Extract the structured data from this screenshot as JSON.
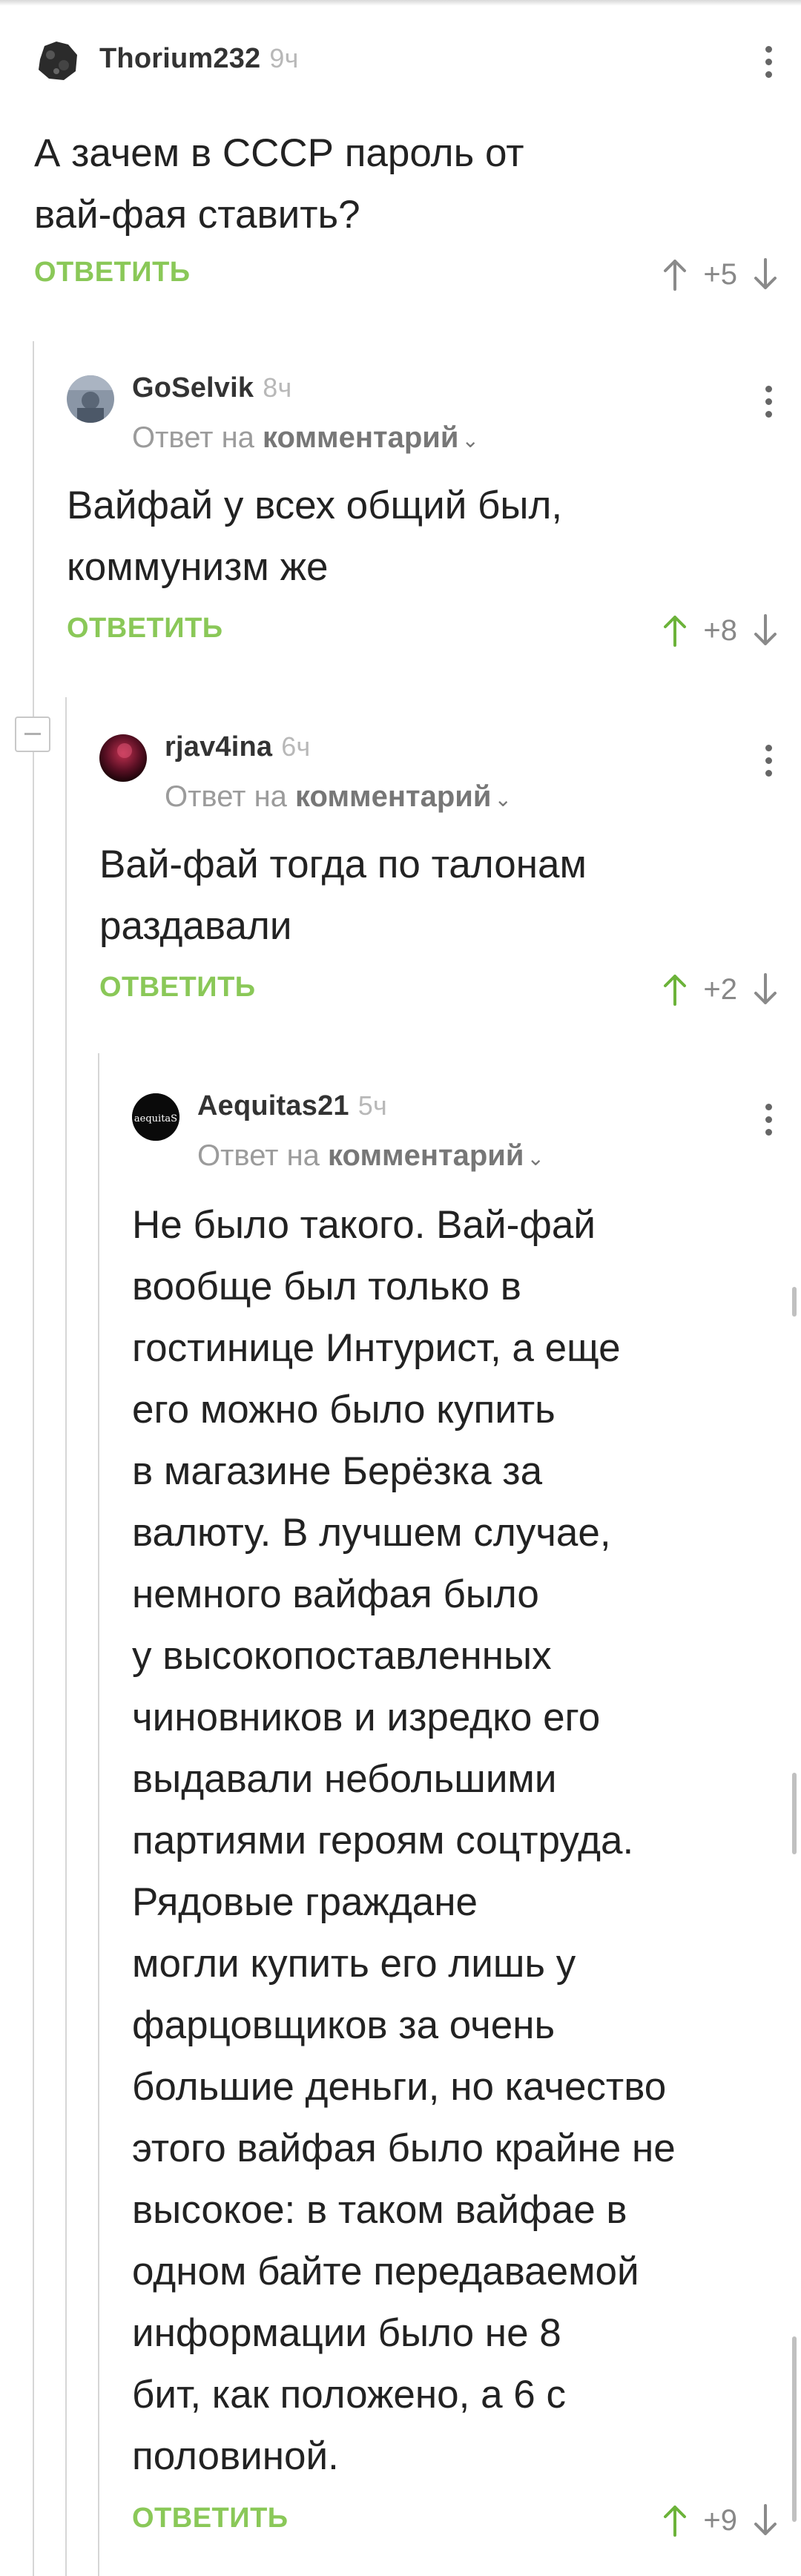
{
  "comments": [
    {
      "author": "Thorium232",
      "time": "9ч",
      "text": "А зачем в СССР пароль от\nвай-фая ставить?",
      "reply_label": "ОТВЕТИТЬ",
      "score": "+5"
    },
    {
      "author": "GoSelvik",
      "time": "8ч",
      "reply_prefix": "Ответ на",
      "reply_target": "комментарий",
      "text": "Вайфай у всех общий был,\nкоммунизм же",
      "reply_label": "ОТВЕТИТЬ",
      "score": "+8"
    },
    {
      "author": "rjav4ina",
      "time": "6ч",
      "reply_prefix": "Ответ на",
      "reply_target": "комментарий",
      "text": "Вай-фай тогда по талонам\nраздавали",
      "reply_label": "ОТВЕТИТЬ",
      "score": "+2"
    },
    {
      "author": "Aequitas21",
      "time": "5ч",
      "reply_prefix": "Ответ на",
      "reply_target": "комментарий",
      "avatar_text": "aequitaS",
      "text": "Не было такого. Вай-фай\nвообще был только в\nгостинице Интурист, а еще\nего можно было купить\nв магазине Берёзка за\nвалюту. В лучшем случае,\nнемного вайфая было\nу высокопоставленных\nчиновников и изредко его\nвыдавали небольшими\nпартиями героям соцтруда.\nРядовые граждане\nмогли купить его лишь у\nфарцовщиков за очень\nбольшие деньги, но качество\nэтого вайфая было крайне не\nвысокое: в таком вайфае в\nодном байте передаваемой\nинформации было не 8\nбит, как положено, а 6 с\nполовиной.",
      "reply_label": "ОТВЕТИТЬ",
      "score": "+9"
    }
  ],
  "colors": {
    "accent_green": "#8ac858",
    "upvoted_green": "#6cb33a",
    "neutral_arrow": "#8a8a8a"
  },
  "icons": [
    "more-vertical-icon",
    "arrow-up-icon",
    "arrow-down-icon",
    "chevron-down-icon",
    "collapse-minus-icon"
  ]
}
